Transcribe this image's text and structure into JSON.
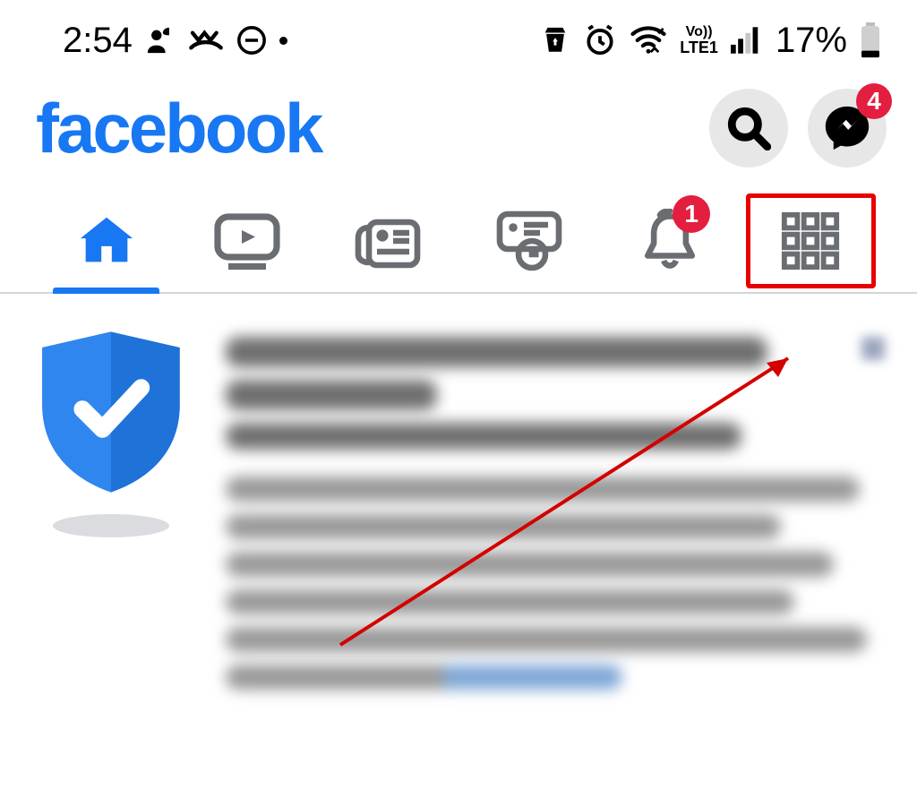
{
  "status_bar": {
    "time": "2:54",
    "battery_percent": "17%",
    "lte_top": "Vo))",
    "lte_bot": "LTE1"
  },
  "header": {
    "brand_text": "facebook",
    "messenger_badge": "4"
  },
  "tabs": {
    "notifications_badge": "1"
  },
  "colors": {
    "brand": "#1877f2",
    "badge": "#e41e3f",
    "highlight": "#e80000"
  }
}
